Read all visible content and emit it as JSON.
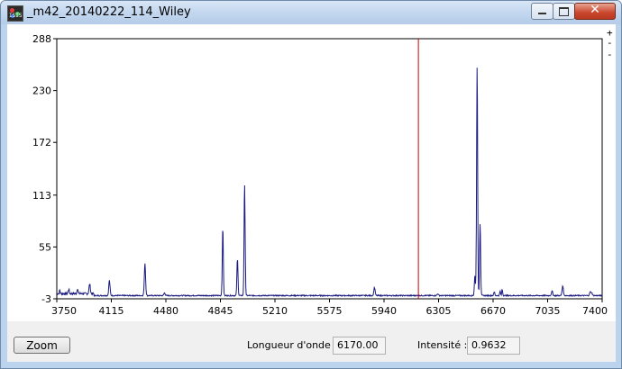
{
  "window": {
    "title": "_m42_20140222_114_Wiley",
    "icon": "isis-app-icon",
    "icon_text": "ISIS"
  },
  "toolbar": {
    "plus": "+",
    "minus": "--"
  },
  "chart_data": {
    "type": "line",
    "title": "",
    "xlabel": "",
    "ylabel": "",
    "xlim": [
      3750,
      7400
    ],
    "ylim": [
      -3,
      288
    ],
    "x_ticks": [
      "3750",
      "4115",
      "4480",
      "4845",
      "5210",
      "5575",
      "5940",
      "6305",
      "6670",
      "7035",
      "7400"
    ],
    "y_ticks": [
      "-3",
      "55",
      "113",
      "172",
      "230",
      "288"
    ],
    "cursor_x": 6170,
    "baseline": 0,
    "peaks": [
      {
        "x": 3770,
        "y": 4,
        "w": 4
      },
      {
        "x": 3830,
        "y": 5,
        "w": 5
      },
      {
        "x": 3889,
        "y": 6,
        "w": 5
      },
      {
        "x": 3970,
        "y": 11,
        "w": 6
      },
      {
        "x": 4102,
        "y": 17,
        "w": 6
      },
      {
        "x": 4340,
        "y": 36,
        "w": 6
      },
      {
        "x": 4471,
        "y": 3,
        "w": 6
      },
      {
        "x": 4861,
        "y": 76,
        "w": 5
      },
      {
        "x": 4959,
        "y": 41,
        "w": 5
      },
      {
        "x": 5007,
        "y": 124,
        "w": 5
      },
      {
        "x": 5876,
        "y": 9,
        "w": 6
      },
      {
        "x": 6300,
        "y": 2,
        "w": 6
      },
      {
        "x": 6548,
        "y": 22,
        "w": 5
      },
      {
        "x": 6563,
        "y": 258,
        "w": 5
      },
      {
        "x": 6583,
        "y": 81,
        "w": 5
      },
      {
        "x": 6678,
        "y": 4,
        "w": 5
      },
      {
        "x": 6717,
        "y": 5,
        "w": 4
      },
      {
        "x": 6731,
        "y": 7,
        "w": 4
      },
      {
        "x": 7065,
        "y": 5,
        "w": 6
      },
      {
        "x": 7136,
        "y": 11,
        "w": 6
      },
      {
        "x": 7320,
        "y": 4,
        "w": 6
      },
      {
        "x": 7330,
        "y": 3,
        "w": 6
      }
    ],
    "series_color": "#1a1a80",
    "cursor_color": "#cc0000"
  },
  "controls": {
    "zoom_label": "Zoom",
    "wavelength_label": "Longueur d'onde :",
    "wavelength_value": "6170.00",
    "intensity_label": "Intensité :",
    "intensity_value": "0.9632"
  }
}
